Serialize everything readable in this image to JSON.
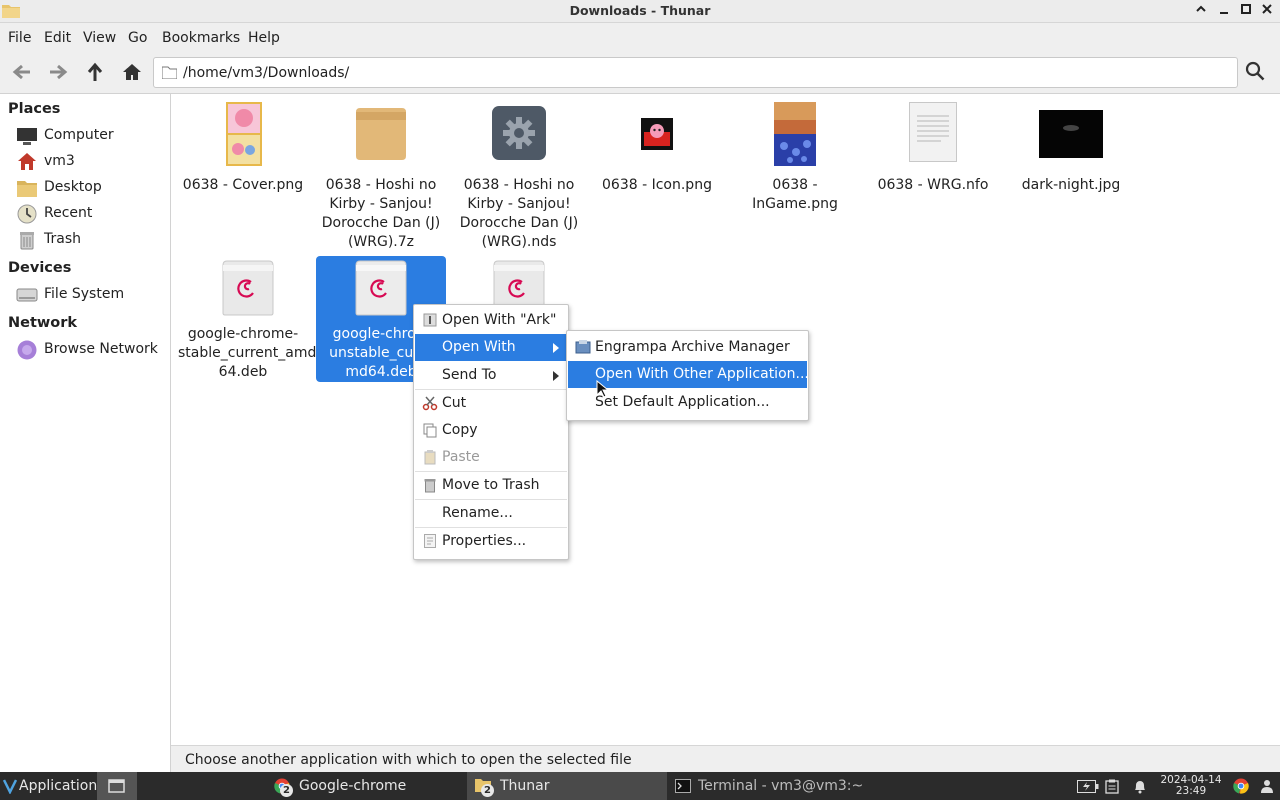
{
  "window": {
    "title": "Downloads - Thunar",
    "buttons": {
      "minimize": "–",
      "restore": "^",
      "maximize": "□",
      "close": "✕"
    }
  },
  "menubar": [
    "File",
    "Edit",
    "View",
    "Go",
    "Bookmarks",
    "Help"
  ],
  "toolbar": {
    "location": "/home/vm3/Downloads/"
  },
  "sidebar": {
    "places_heading": "Places",
    "places": [
      {
        "label": "Computer",
        "icon": "monitor-icon"
      },
      {
        "label": "vm3",
        "icon": "home-icon"
      },
      {
        "label": "Desktop",
        "icon": "folder-icon"
      },
      {
        "label": "Recent",
        "icon": "clock-icon"
      },
      {
        "label": "Trash",
        "icon": "trash-icon"
      }
    ],
    "devices_heading": "Devices",
    "devices": [
      {
        "label": "File System",
        "icon": "drive-icon"
      }
    ],
    "network_heading": "Network",
    "network": [
      {
        "label": "Browse Network",
        "icon": "network-icon"
      }
    ]
  },
  "files": [
    {
      "name_lines": [
        "0638 - Cover.png"
      ],
      "icon": "cover-image-thumbnail"
    },
    {
      "name_lines": [
        "0638 - Hoshi no",
        "Kirby - Sanjou!",
        "Dorocche Dan (J)",
        "(WRG).7z"
      ],
      "icon": "archive-box-icon"
    },
    {
      "name_lines": [
        "0638 - Hoshi no",
        "Kirby - Sanjou!",
        "Dorocche Dan (J)",
        "(WRG).nds"
      ],
      "icon": "gear-file-icon"
    },
    {
      "name_lines": [
        "0638 - Icon.png"
      ],
      "icon": "kirby-icon-thumbnail"
    },
    {
      "name_lines": [
        "0638 - InGame.png"
      ],
      "icon": "ingame-screenshot-thumbnail"
    },
    {
      "name_lines": [
        "0638 - WRG.nfo"
      ],
      "icon": "text-document-icon"
    },
    {
      "name_lines": [
        "dark-night.jpg"
      ],
      "icon": "dark-image-thumbnail"
    },
    {
      "name_lines": [
        "google-chrome-",
        "stable_current_amd",
        "64.deb"
      ],
      "icon": "debian-package-icon"
    },
    {
      "name_lines": [
        "google-chrom",
        "unstable_curre",
        "md64.deb"
      ],
      "icon": "debian-package-icon",
      "selected": true
    },
    {
      "name_lines": [
        ""
      ],
      "icon": "debian-package-icon"
    }
  ],
  "context_menu": {
    "items": [
      {
        "label": "Open With \"Ark\"",
        "icon": "ark-icon"
      },
      {
        "label": "Open With",
        "submenu": true,
        "highlighted": true
      },
      {
        "label": "Send To",
        "submenu": true
      },
      {
        "label": "Cut",
        "icon": "scissors-icon"
      },
      {
        "label": "Copy",
        "icon": "copy-icon"
      },
      {
        "label": "Paste",
        "icon": "paste-icon",
        "disabled": true
      },
      {
        "label": "Move to Trash",
        "icon": "trash-icon"
      },
      {
        "label": "Rename..."
      },
      {
        "label": "Properties...",
        "icon": "properties-icon"
      }
    ]
  },
  "submenu": {
    "items": [
      {
        "label": "Engrampa Archive Manager",
        "icon": "engrampa-icon"
      },
      {
        "label": "Open With Other Application...",
        "highlighted": true
      },
      {
        "label": "Set Default Application..."
      }
    ]
  },
  "statusbar": {
    "text": "Choose another application with which to open the selected file"
  },
  "taskbar": {
    "applications": "Applications",
    "tasks": [
      {
        "label": "Google-chrome",
        "count": "2"
      },
      {
        "label": "Thunar",
        "count": "2"
      },
      {
        "label": "Terminal - vm3@vm3:~"
      }
    ],
    "clock_date": "2024-04-14",
    "clock_time": "23:49"
  },
  "colors": {
    "selection": "#2b7de1",
    "taskbar": "#2b2b2b"
  }
}
